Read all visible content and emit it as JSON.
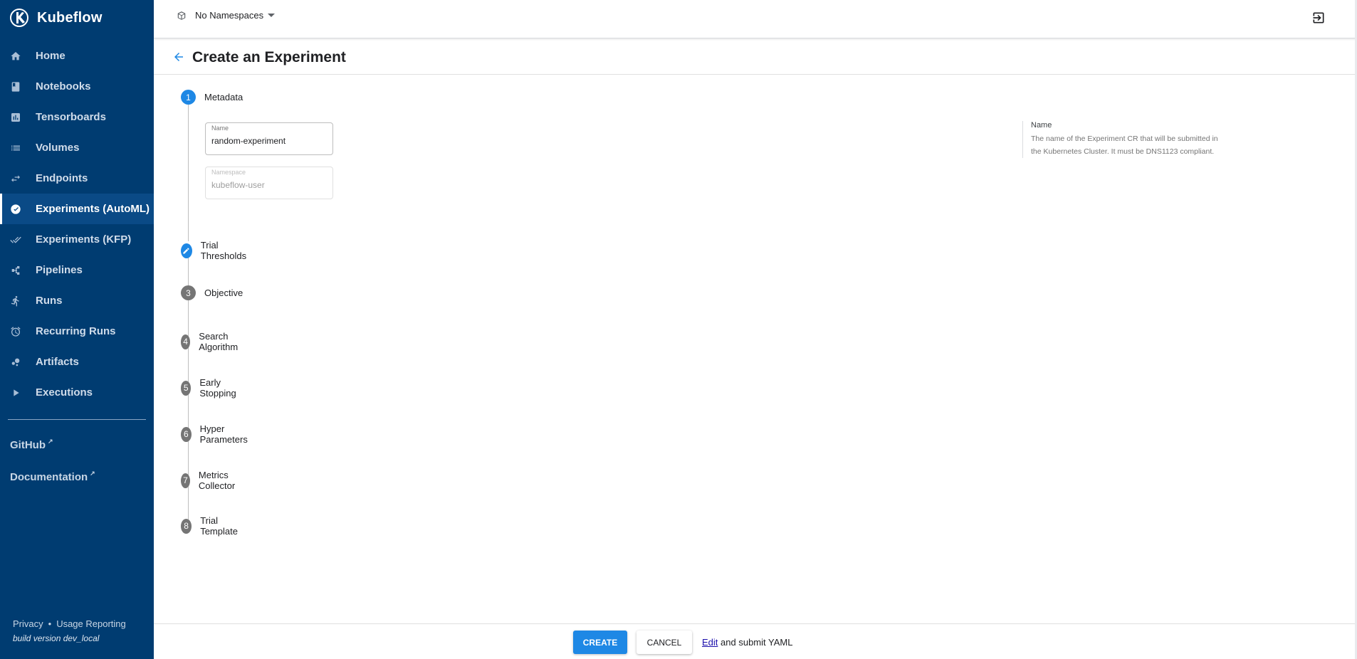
{
  "sidebar": {
    "brand": "Kubeflow",
    "items": [
      {
        "label": "Home",
        "icon": "home-icon"
      },
      {
        "label": "Notebooks",
        "icon": "book-icon"
      },
      {
        "label": "Tensorboards",
        "icon": "chart-icon"
      },
      {
        "label": "Volumes",
        "icon": "list-icon"
      },
      {
        "label": "Endpoints",
        "icon": "swap-icon"
      },
      {
        "label": "Experiments (AutoML)",
        "icon": "speed-icon",
        "active": true
      },
      {
        "label": "Experiments (KFP)",
        "icon": "done-all-icon"
      },
      {
        "label": "Pipelines",
        "icon": "pipeline-icon"
      },
      {
        "label": "Runs",
        "icon": "runner-icon"
      },
      {
        "label": "Recurring Runs",
        "icon": "alarm-icon"
      },
      {
        "label": "Artifacts",
        "icon": "bubbles-icon"
      },
      {
        "label": "Executions",
        "icon": "play-icon"
      }
    ],
    "links": {
      "github": "GitHub",
      "documentation": "Documentation"
    },
    "footer": {
      "privacy": "Privacy",
      "separator": "•",
      "usage": "Usage Reporting",
      "build": "build version dev_local"
    }
  },
  "topbar": {
    "namespace": "No Namespaces"
  },
  "page": {
    "title": "Create an Experiment"
  },
  "stepper": {
    "steps": [
      {
        "number": "1",
        "label": "Metadata",
        "state": "active"
      },
      {
        "number": "",
        "label": "Trial Thresholds",
        "state": "edit"
      },
      {
        "number": "3",
        "label": "Objective",
        "state": "pending"
      },
      {
        "number": "4",
        "label": "Search Algorithm",
        "state": "pending"
      },
      {
        "number": "5",
        "label": "Early Stopping",
        "state": "pending"
      },
      {
        "number": "6",
        "label": "Hyper Parameters",
        "state": "pending"
      },
      {
        "number": "7",
        "label": "Metrics Collector",
        "state": "pending"
      },
      {
        "number": "8",
        "label": "Trial Template",
        "state": "pending"
      }
    ]
  },
  "form": {
    "name": {
      "label": "Name",
      "value": "random-experiment"
    },
    "namespace": {
      "label": "Namespace",
      "value": "kubeflow-user"
    }
  },
  "help": {
    "title": "Name",
    "text": "The name of the Experiment CR that will be submitted in the Kubernetes Cluster. It must be DNS1123 compliant."
  },
  "actions": {
    "create": "CREATE",
    "cancel": "CANCEL",
    "edit": "Edit",
    "yaml_suffix": "and submit YAML"
  },
  "colors": {
    "sidebar_bg": "#003c71",
    "primary": "#1e88e5",
    "step_pending": "#757575"
  }
}
